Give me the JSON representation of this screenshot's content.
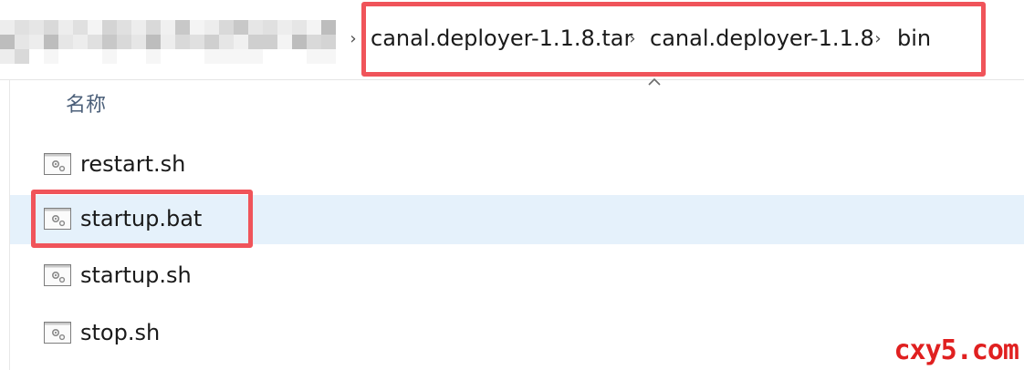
{
  "breadcrumb": {
    "items": [
      {
        "label": "canal.deployer-1.1.8.tar"
      },
      {
        "label": "canal.deployer-1.1.8"
      },
      {
        "label": "bin"
      }
    ]
  },
  "file_list": {
    "column_header": "名称",
    "files": [
      {
        "name": "restart.sh",
        "selected": false
      },
      {
        "name": "startup.bat",
        "selected": true
      },
      {
        "name": "startup.sh",
        "selected": false
      },
      {
        "name": "stop.sh",
        "selected": false
      }
    ]
  },
  "colors": {
    "annotation_red": "#f0545a",
    "selected_row": "#e5f1fb",
    "header_text": "#4c607a",
    "watermark": "#e02020"
  },
  "icons": {
    "file": "script-file-icon",
    "separator": "chevron-right-icon",
    "sort": "chevron-up-icon"
  },
  "watermark": "cxy5.com"
}
